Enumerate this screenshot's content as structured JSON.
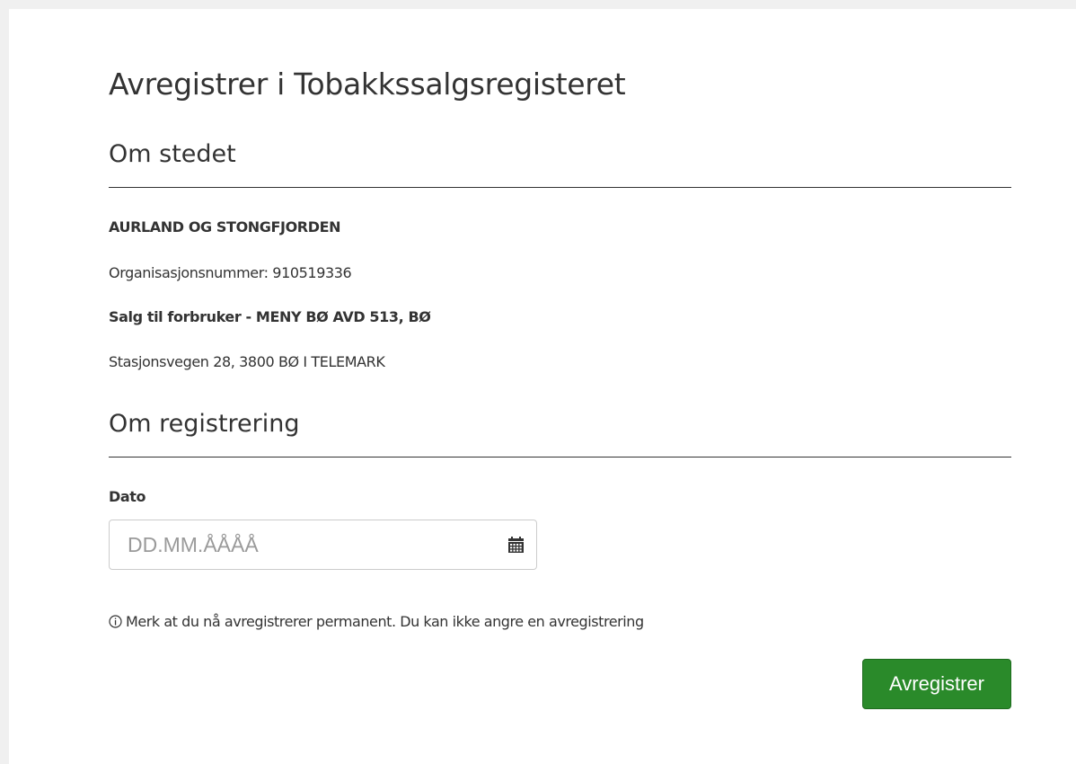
{
  "page": {
    "title": "Avregistrer i Tobakkssalgsregisteret"
  },
  "place_section": {
    "heading": "Om stedet",
    "company_name": "AURLAND OG STONGFJORDEN",
    "org_number_label": "Organisasjonsnummer: 910519336",
    "sale_type": "Salg til forbruker - MENY BØ AVD 513, BØ",
    "address": "Stasjonsvegen 28, 3800 BØ I TELEMARK"
  },
  "registration_section": {
    "heading": "Om registrering",
    "date_label": "Dato",
    "date_placeholder": "DD.MM.ÅÅÅÅ",
    "date_value": "",
    "notice_text": "Merk at du nå avregistrerer permanent. Du kan ikke angre en avregistrering",
    "submit_label": "Avregistrer"
  },
  "icons": {
    "calendar": "calendar-icon",
    "info": "info-icon"
  },
  "colors": {
    "submit_button": "#2a8a2a",
    "text": "#333333",
    "frame_border": "#f0f0f0"
  }
}
